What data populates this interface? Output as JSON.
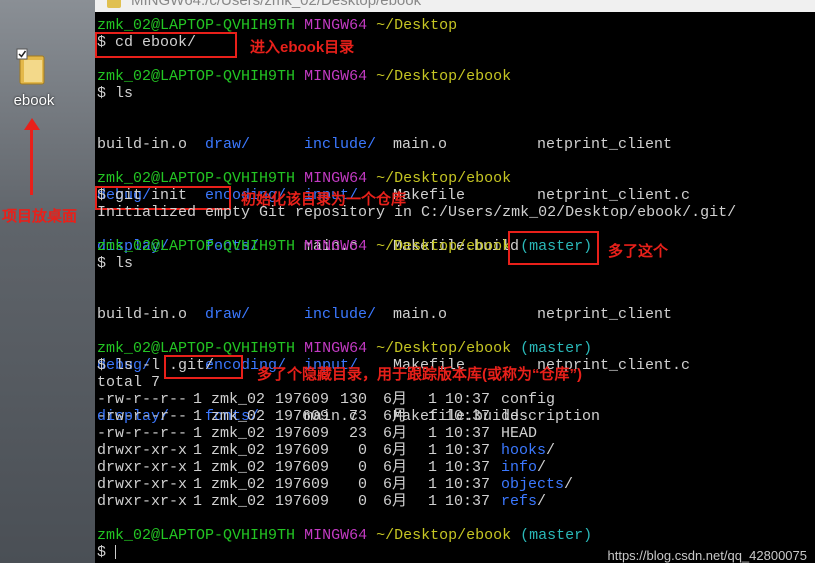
{
  "window": {
    "title": "MINGW64:/c/Users/zmk_02/Desktop/ebook"
  },
  "desktop": {
    "icon_label": "ebook",
    "note": "项目放桌面"
  },
  "prompts": {
    "user_host": "zmk_02@LAPTOP-QVHIH9TH",
    "system": "MINGW64",
    "path_desktop": "~/Desktop",
    "path_ebook": "~/Desktop/ebook",
    "branch": "(master)"
  },
  "commands": {
    "cd": "$ cd ebook/",
    "ls1": "$ ls",
    "git_init": "$ git init",
    "git_init_output": "Initialized empty Git repository in C:/Users/zmk_02/Desktop/ebook/.git/",
    "ls2": "$ ls",
    "ls_l": "$ ls -l",
    "ls_l_arg": ".git/",
    "total": "total 7",
    "final": "$ "
  },
  "ls_listing": {
    "col1": [
      "build-in.o",
      "debug/",
      "display/"
    ],
    "col2": [
      "draw/",
      "encoding/",
      "fonts/"
    ],
    "col3": [
      "include/",
      "input/",
      "main.c"
    ],
    "col4": [
      "main.o",
      "Makefile",
      "Makefile.build"
    ],
    "col5": [
      "netprint_client",
      "netprint_client.c",
      ""
    ]
  },
  "ls_l_rows": [
    {
      "perm": "-rw-r--r--",
      "links": "1",
      "owner": "zmk_02",
      "group": "197609",
      "size": "130",
      "month": "6月",
      "day": "1",
      "time": "10:37",
      "name": "config",
      "is_dir": false
    },
    {
      "perm": "-rw-r--r--",
      "links": "1",
      "owner": "zmk_02",
      "group": "197609",
      "size": "73",
      "month": "6月",
      "day": "1",
      "time": "10:37",
      "name": "description",
      "is_dir": false
    },
    {
      "perm": "-rw-r--r--",
      "links": "1",
      "owner": "zmk_02",
      "group": "197609",
      "size": "23",
      "month": "6月",
      "day": "1",
      "time": "10:37",
      "name": "HEAD",
      "is_dir": false
    },
    {
      "perm": "drwxr-xr-x",
      "links": "1",
      "owner": "zmk_02",
      "group": "197609",
      "size": "0",
      "month": "6月",
      "day": "1",
      "time": "10:37",
      "name": "hooks",
      "is_dir": true
    },
    {
      "perm": "drwxr-xr-x",
      "links": "1",
      "owner": "zmk_02",
      "group": "197609",
      "size": "0",
      "month": "6月",
      "day": "1",
      "time": "10:37",
      "name": "info",
      "is_dir": true
    },
    {
      "perm": "drwxr-xr-x",
      "links": "1",
      "owner": "zmk_02",
      "group": "197609",
      "size": "0",
      "month": "6月",
      "day": "1",
      "time": "10:37",
      "name": "objects",
      "is_dir": true
    },
    {
      "perm": "drwxr-xr-x",
      "links": "1",
      "owner": "zmk_02",
      "group": "197609",
      "size": "0",
      "month": "6月",
      "day": "1",
      "time": "10:37",
      "name": "refs",
      "is_dir": true
    }
  ],
  "annotations": {
    "cd_note": "进入ebook目录",
    "init_note": "初始化该目录为一个仓库",
    "master_note": "多了这个",
    "git_note": "多了个隐藏目录，用于跟踪版本库(或称为“仓库”)"
  },
  "colors": {
    "annotation_red": "#e8201a",
    "prompt_green": "#23c523",
    "prompt_magenta": "#c23ac2",
    "prompt_yellow": "#c5c523",
    "branch_cyan": "#2ab8b8",
    "dir_blue": "#3b78ff"
  },
  "watermark": "https://blog.csdn.net/qq_42800075"
}
